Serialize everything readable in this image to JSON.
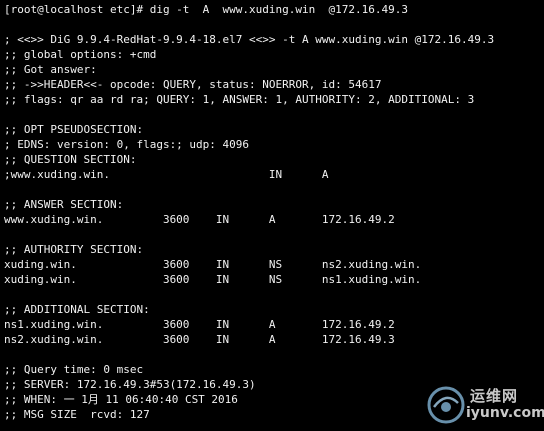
{
  "terminal": {
    "lines": [
      "[root@localhost etc]# dig -t  A  www.xuding.win  @172.16.49.3",
      "",
      "; <<>> DiG 9.9.4-RedHat-9.9.4-18.el7 <<>> -t A www.xuding.win @172.16.49.3",
      ";; global options: +cmd",
      ";; Got answer:",
      ";; ->>HEADER<<- opcode: QUERY, status: NOERROR, id: 54617",
      ";; flags: qr aa rd ra; QUERY: 1, ANSWER: 1, AUTHORITY: 2, ADDITIONAL: 3",
      "",
      ";; OPT PSEUDOSECTION:",
      "; EDNS: version: 0, flags:; udp: 4096",
      ";; QUESTION SECTION:",
      ";www.xuding.win.                        IN      A",
      "",
      ";; ANSWER SECTION:",
      "www.xuding.win.         3600    IN      A       172.16.49.2",
      "",
      ";; AUTHORITY SECTION:",
      "xuding.win.             3600    IN      NS      ns2.xuding.win.",
      "xuding.win.             3600    IN      NS      ns1.xuding.win.",
      "",
      ";; ADDITIONAL SECTION:",
      "ns1.xuding.win.         3600    IN      A       172.16.49.2",
      "ns2.xuding.win.         3600    IN      A       172.16.49.3",
      "",
      ";; Query time: 0 msec",
      ";; SERVER: 172.16.49.3#53(172.16.49.3)",
      ";; WHEN: 一 1月 11 06:40:40 CST 2016",
      ";; MSG SIZE  rcvd: 127"
    ]
  },
  "watermark": {
    "name": "运维网",
    "url": "iyunv.com"
  },
  "colors": {
    "background": "#000000",
    "text": "#f2f2f2",
    "watermark": "#c9c9c9"
  }
}
